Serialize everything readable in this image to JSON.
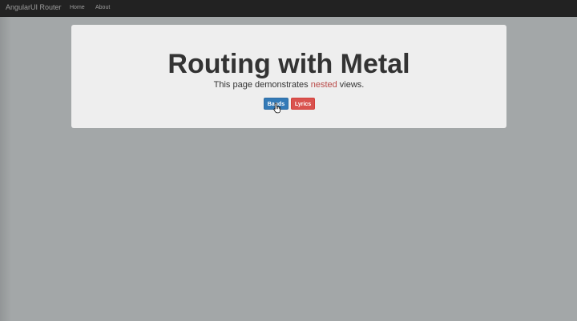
{
  "navbar": {
    "brand": "AngularUI Router",
    "links": [
      {
        "label": "Home"
      },
      {
        "label": "About"
      }
    ]
  },
  "jumbotron": {
    "title": "Routing with Metal",
    "subtitle_before": "This page demonstrates ",
    "subtitle_highlight": "nested",
    "subtitle_after": " views.",
    "buttons": [
      {
        "label": "Bands",
        "color": "#337ab7"
      },
      {
        "label": "Lyrics",
        "color": "#d9534f"
      }
    ]
  },
  "colors": {
    "navbar": "#222222",
    "page_background": "#a3a7a8",
    "jumbotron": "#eeeeee",
    "highlight": "#b94a48"
  },
  "cursor": {
    "icon": "hand-pointer-icon"
  }
}
